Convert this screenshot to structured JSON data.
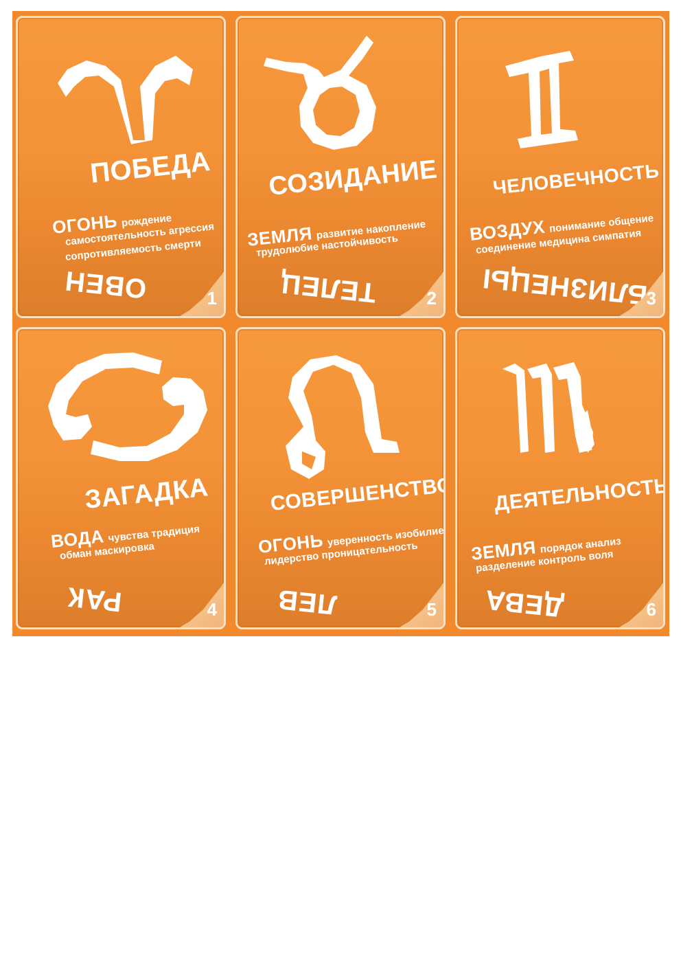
{
  "cards": [
    {
      "title": "ПОБЕДА",
      "element": "ОГОНЬ",
      "kw1": "рождение",
      "kw2": "самостоятельность агрессия",
      "kw3": "сопротивляемость смерти",
      "sign": "ОВЕН",
      "number": "1",
      "symbol_icon": "aries-icon"
    },
    {
      "title": "СОЗИДАНИЕ",
      "element": "ЗЕМЛЯ",
      "kw1": "развитие накопление",
      "kw2": "трудолюбие настойчивость",
      "kw3": "",
      "sign": "ТЕЛЕЦ",
      "number": "2",
      "symbol_icon": "taurus-icon"
    },
    {
      "title": "ЧЕЛОВЕЧНОСТЬ",
      "element": "ВОЗДУХ",
      "kw1": "понимание общение",
      "kw2": "соединение  медицина симпатия",
      "kw3": "",
      "sign": "БЛИЗНЕЦЫ",
      "number": "3",
      "symbol_icon": "gemini-icon"
    },
    {
      "title": "ЗАГАДКА",
      "element": "ВОДА",
      "kw1": "чувства традиция",
      "kw2": "обман маскировка",
      "kw3": "",
      "sign": "РАК",
      "number": "4",
      "symbol_icon": "cancer-icon"
    },
    {
      "title": "СОВЕРШЕНСТВО",
      "element": "ОГОНЬ",
      "kw1": "уверенность изобилие",
      "kw2": "лидерство  проницательность",
      "kw3": "",
      "sign": "ЛЕВ",
      "number": "5",
      "symbol_icon": "leo-icon"
    },
    {
      "title": "ДЕЯТЕЛЬНОСТЬ",
      "element": "ЗЕМЛЯ",
      "kw1": "порядок анализ",
      "kw2": "разделение контроль воля",
      "kw3": "",
      "sign": "ДЕВА",
      "number": "6",
      "symbol_icon": "virgo-icon"
    }
  ],
  "colors": {
    "card": "#f39237",
    "frame": "#fbe0c0",
    "text": "#ffffff",
    "sheet": "#f2892d"
  }
}
